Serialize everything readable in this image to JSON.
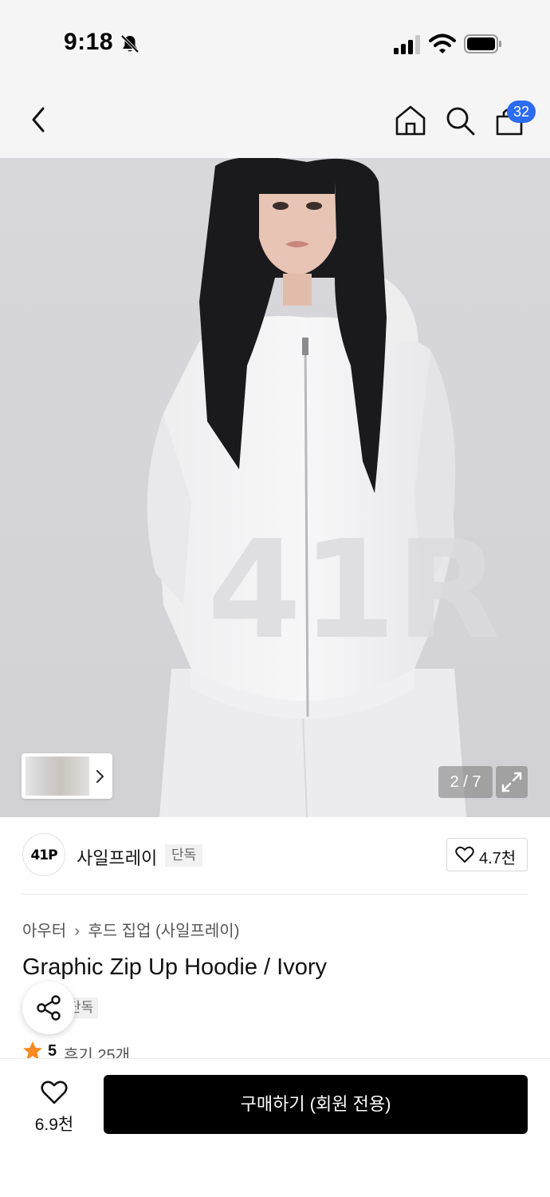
{
  "status_bar": {
    "time": "9:18"
  },
  "nav": {
    "cart_count": "32"
  },
  "gallery": {
    "counter": "2 / 7",
    "current_index": 2,
    "total": 7
  },
  "brand": {
    "logo_text": "41P",
    "name": "사일프레이",
    "tag": "단독",
    "likes": "4.7천"
  },
  "product": {
    "breadcrumb": [
      "아우터",
      "후드 집업 (사일프레이)"
    ],
    "title": "Graphic Zip Up Hoodie / Ivory",
    "exclusive_tag": "단독",
    "rating": "5",
    "review_label": "후기 25개"
  },
  "bottom_bar": {
    "wishlist_count": "6.9천",
    "buy_label": "구매하기 (회원 전용)"
  },
  "colors": {
    "badge": "#2b6cf0",
    "star": "#f58a1f",
    "buy_button": "#000000"
  }
}
